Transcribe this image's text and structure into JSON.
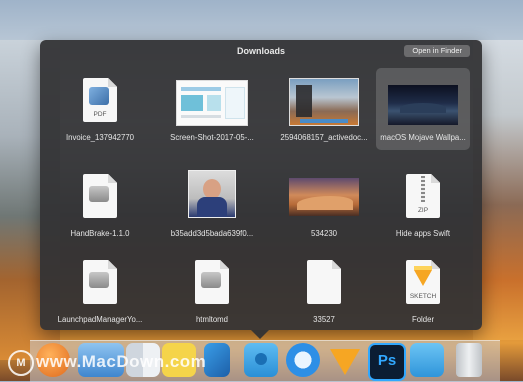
{
  "stack": {
    "title": "Downloads",
    "open_button": "Open in Finder",
    "items": [
      {
        "label": "Invoice_137942770",
        "icon": "pdf-document-icon",
        "tag": "PDF"
      },
      {
        "label": "Screen-Shot-2017-05-...",
        "icon": "screenshot-thumbnail"
      },
      {
        "label": "2594068157_activedoc...",
        "icon": "desktop-screenshot-thumbnail"
      },
      {
        "label": "macOS Mojave Wallpa...",
        "icon": "mojave-wallpaper-thumbnail",
        "selected": true
      },
      {
        "label": "HandBrake-1.1.0",
        "icon": "disk-image-icon"
      },
      {
        "label": "b35add3d5bada639f0...",
        "icon": "photo-thumbnail"
      },
      {
        "label": "534230",
        "icon": "desert-wallpaper-thumbnail"
      },
      {
        "label": "Hide apps Swift",
        "icon": "zip-archive-icon",
        "tag": "ZIP"
      },
      {
        "label": "LaunchpadManagerYo...",
        "icon": "disk-image-icon"
      },
      {
        "label": "htmltomd",
        "icon": "disk-image-icon"
      },
      {
        "label": "33527",
        "icon": "blank-document-icon"
      },
      {
        "label": "Folder",
        "icon": "sketch-document-icon",
        "tag": "SKETCH"
      }
    ]
  },
  "dock": {
    "items": [
      "launchpad-icon",
      "finder-window-icon",
      "finder-icon",
      "notes-icon",
      "xcode-icon",
      "downloads-folder-icon",
      "safari-icon",
      "sketch-icon",
      "photoshop-icon",
      "folder-icon",
      "trash-icon"
    ],
    "photoshop_text": "Ps"
  },
  "watermark": {
    "logo": "M",
    "text": "www.MacDown.com"
  },
  "colors": {
    "panel": "#323234",
    "selection": "rgba(255,255,255,0.16)",
    "label": "#e6e6e6"
  }
}
